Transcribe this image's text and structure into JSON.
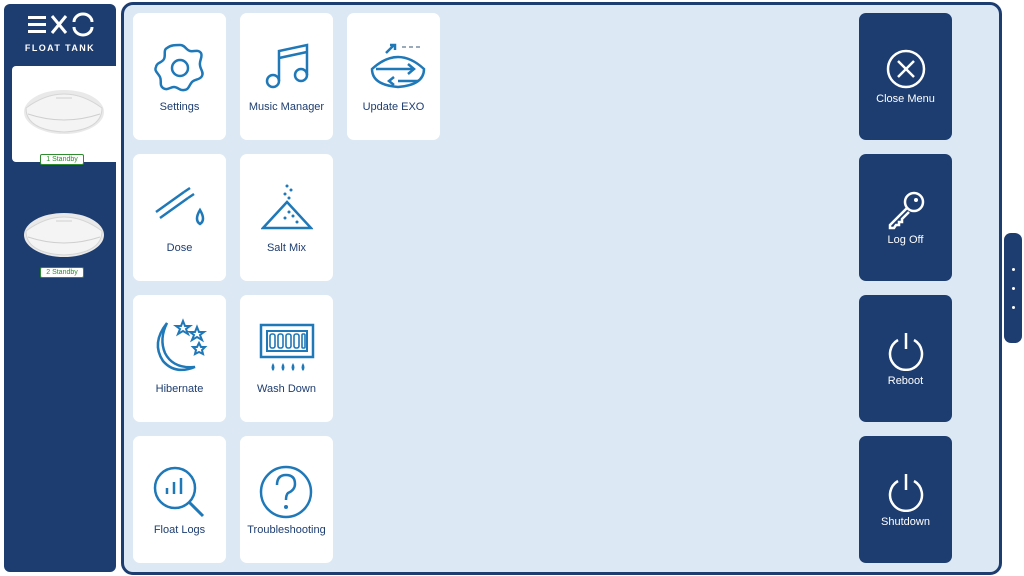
{
  "brand": {
    "logo_text": "FLOAT TANK",
    "wordmark": "EXO"
  },
  "tanks": [
    {
      "label": "1  Standby",
      "selected": true
    },
    {
      "label": "2  Standby",
      "selected": false
    }
  ],
  "menu": {
    "settings": "Settings",
    "music_manager": "Music Manager",
    "update_exo": "Update EXO",
    "dose": "Dose",
    "salt_mix": "Salt Mix",
    "hibernate": "Hibernate",
    "wash_down": "Wash Down",
    "float_logs": "Float Logs",
    "troubleshooting": "Troubleshooting"
  },
  "actions": {
    "close_menu": "Close Menu",
    "log_off": "Log Off",
    "reboot": "Reboot",
    "shutdown": "Shutdown"
  },
  "colors": {
    "navy": "#1d3d70",
    "panel": "#dce8f3",
    "icon_blue": "#1f78b8",
    "status_green": "#2e8b2e"
  }
}
